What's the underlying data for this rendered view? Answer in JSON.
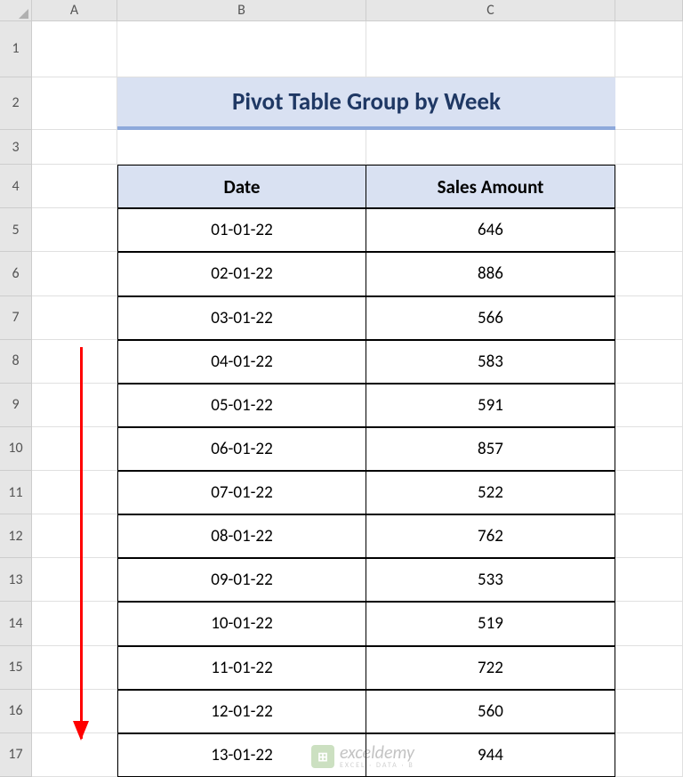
{
  "columns": [
    "A",
    "B",
    "C"
  ],
  "title": "Pivot Table Group by Week",
  "table": {
    "headers": [
      "Date",
      "Sales Amount"
    ],
    "rows": [
      {
        "date": "01-01-22",
        "amount": "646"
      },
      {
        "date": "02-01-22",
        "amount": "886"
      },
      {
        "date": "03-01-22",
        "amount": "566"
      },
      {
        "date": "04-01-22",
        "amount": "583"
      },
      {
        "date": "05-01-22",
        "amount": "591"
      },
      {
        "date": "06-01-22",
        "amount": "857"
      },
      {
        "date": "07-01-22",
        "amount": "522"
      },
      {
        "date": "08-01-22",
        "amount": "762"
      },
      {
        "date": "09-01-22",
        "amount": "533"
      },
      {
        "date": "10-01-22",
        "amount": "519"
      },
      {
        "date": "11-01-22",
        "amount": "722"
      },
      {
        "date": "12-01-22",
        "amount": "560"
      },
      {
        "date": "13-01-22",
        "amount": "944"
      }
    ]
  },
  "rowNumbers": [
    "1",
    "2",
    "3",
    "4",
    "5",
    "6",
    "7",
    "8",
    "9",
    "10",
    "11",
    "12",
    "13",
    "14",
    "15",
    "16",
    "17"
  ],
  "watermark": {
    "main": "exceldemy",
    "sub": "EXCEL · DATA · B"
  }
}
